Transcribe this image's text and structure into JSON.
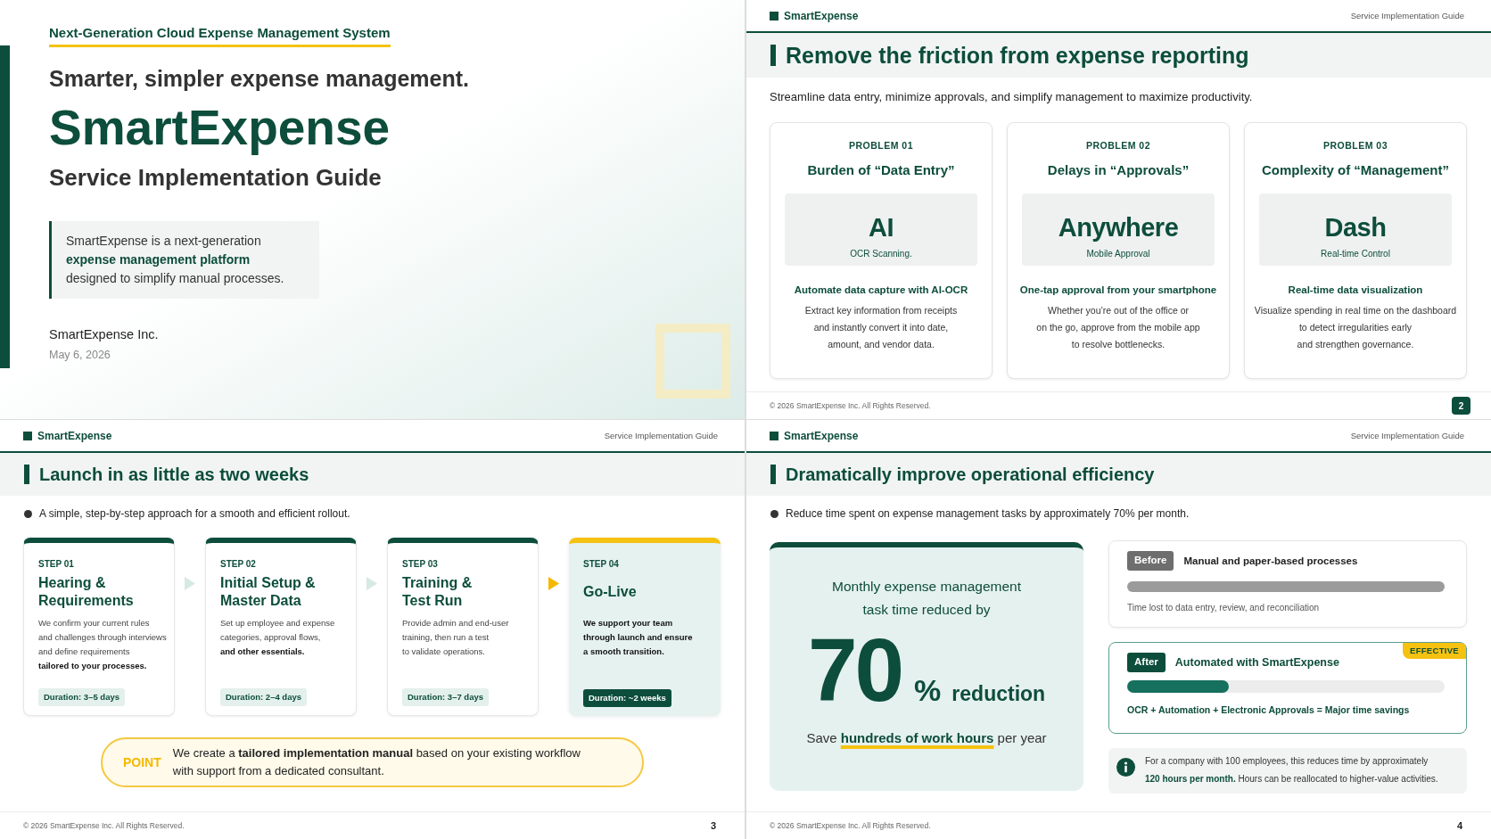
{
  "slides": [
    {
      "kind": "title",
      "tagline": "Next-Generation Cloud Expense Management System",
      "headline": "Smarter, simpler expense management.",
      "product": "SmartExpense",
      "subtitle": "Service Implementation Guide",
      "summary": "SmartExpense is a next-generation\n**expense management platform**\ndesigned to simplify manual processes.",
      "company": "SmartExpense Inc.",
      "date": "May 6, 2026"
    },
    {
      "kind": "problems",
      "header": {
        "brand": "SmartExpense",
        "guide": "Service Implementation Guide"
      },
      "title": "Remove the friction from expense reporting",
      "lead": "Streamline data entry, minimize approvals, and simplify management to maximize productivity.",
      "problems": [
        {
          "label": "PROBLEM 01",
          "title": "Burden of “Data Entry”",
          "keyword": "AI",
          "caption": "OCR Scanning.",
          "heading": "Automate data capture with AI-OCR",
          "description": "Extract key information from receipts\nand instantly convert it into date,\namount, and vendor data."
        },
        {
          "label": "PROBLEM 02",
          "title": "Delays in “Approvals”",
          "keyword": "Anywhere",
          "caption": "Mobile Approval",
          "heading": "One-tap approval from your smartphone",
          "description": "Whether you’re out of the office or\non the go, approve from the mobile app\nto resolve bottlenecks."
        },
        {
          "label": "PROBLEM 03",
          "title": "Complexity of “Management”",
          "keyword": "Dash",
          "caption": "Real-time Control",
          "heading": "Real-time data visualization",
          "description": "Visualize spending in real time on the dashboard\nto detect irregularities early\nand strengthen governance."
        }
      ],
      "footer": {
        "copyright": "© 2026 SmartExpense Inc. All Rights Reserved.",
        "page": {
          "number": "2",
          "kind": "badge"
        }
      }
    },
    {
      "kind": "steps",
      "header": {
        "brand": "SmartExpense",
        "guide": "Service Implementation Guide"
      },
      "title": "Launch in as little as two weeks",
      "lead": "A simple, step-by-step approach for a smooth and efficient rollout.",
      "steps": [
        {
          "label": "STEP 01",
          "title": "Hearing &\nRequirements",
          "description": "We confirm your current rules\nand challenges through interviews\nand define requirements\n**tailored to your processes.**",
          "duration": "Duration: 3–5 days",
          "highlighted": false
        },
        {
          "label": "STEP 02",
          "title": "Initial Setup &\nMaster Data",
          "description": "Set up employee and expense\ncategories, approval flows,\n**and other essentials.**",
          "duration": "Duration: 2–4 days",
          "highlighted": false
        },
        {
          "label": "STEP 03",
          "title": "Training &\nTest Run",
          "description": "Provide admin and end-user\ntraining, then run a test\nto validate operations.",
          "duration": "Duration: 3–7 days",
          "highlighted": false
        },
        {
          "label": "STEP 04",
          "title": "Go-Live",
          "description": "We support your team\nthrough launch and ensure\na smooth transition.",
          "duration": "Duration: ~2 weeks",
          "highlighted": true
        }
      ],
      "point": {
        "label": "POINT",
        "text": "We create a **tailored implementation manual** based on your existing workflow\nwith support from a dedicated consultant."
      },
      "footer": {
        "copyright": "© 2026 SmartExpense Inc. All Rights Reserved.",
        "page": {
          "number": "3",
          "kind": "plain"
        }
      }
    },
    {
      "kind": "results",
      "header": {
        "brand": "SmartExpense",
        "guide": "Service Implementation Guide"
      },
      "title": "Dramatically improve operational efficiency",
      "lead": "Reduce time spent on expense management tasks by approximately 70% per month.",
      "stat": {
        "intro": "Monthly expense management\ntask time reduced by",
        "value": "70",
        "unit": "%",
        "suffix": "reduction",
        "note": "Save **hundreds of work hours** per year"
      },
      "comparisons": [
        {
          "kind": "before",
          "badge": "Before",
          "title": "Manual and paper-based processes",
          "caption": "Time lost to data entry, review, and reconciliation"
        },
        {
          "kind": "after",
          "badge": "After",
          "title": "Automated with SmartExpense",
          "level": 0.32,
          "caption": "OCR + Automation + Electronic Approvals = Major time savings",
          "tag": "EFFECTIVE"
        }
      ],
      "info": {
        "text": "For a company with 100 employees, this reduces time by approximately\n**120 hours per month.** Hours can be reallocated to higher-value activities."
      },
      "footer": {
        "copyright": "© 2026 SmartExpense Inc. All Rights Reserved.",
        "page": {
          "number": "4",
          "kind": "plain"
        }
      }
    }
  ]
}
